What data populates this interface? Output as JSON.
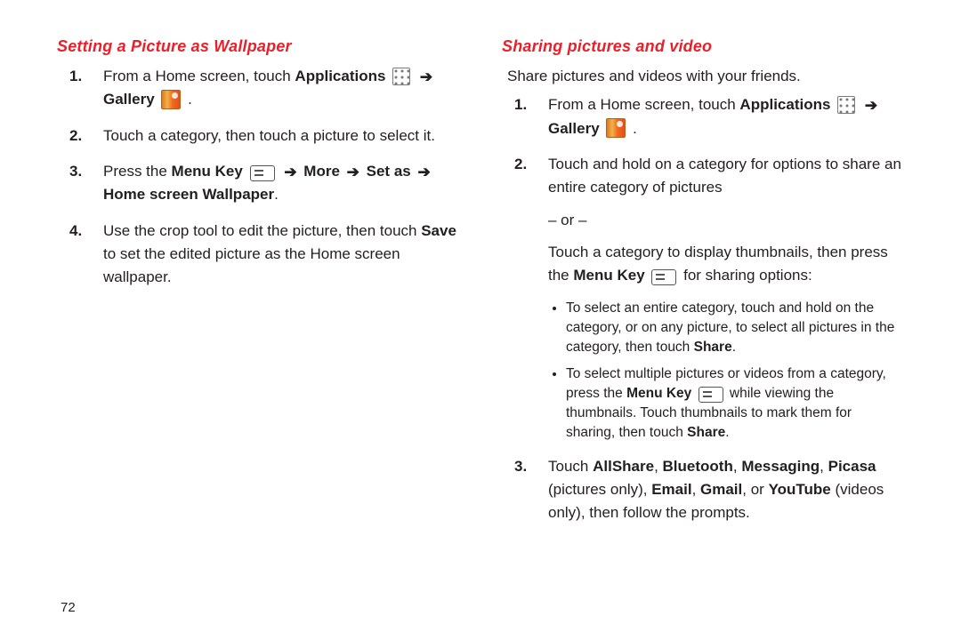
{
  "left": {
    "title": "Setting a Picture as Wallpaper",
    "steps": {
      "s1a": "From a Home screen, touch ",
      "s1_applications": "Applications",
      "s1_gallery": "Gallery",
      "period": ".",
      "s2": "Touch a category, then touch a picture to select it.",
      "s3a": "Press the ",
      "s3_menu": "Menu Key",
      "s3_more": "More",
      "s3_setas": "Set as",
      "s3_home": "Home screen Wallpaper",
      "s4a": "Use the crop tool to edit the picture, then touch ",
      "s4_save": "Save",
      "s4b": " to set the edited picture as the Home screen wallpaper."
    }
  },
  "right": {
    "title": "Sharing pictures and video",
    "intro": "Share pictures and videos with your friends.",
    "steps": {
      "s1a": "From a Home screen, touch ",
      "s1_applications": "Applications",
      "s1_gallery": "Gallery",
      "period": ".",
      "s2a": "Touch and hold on a category for options to share an entire category of pictures",
      "or": "– or –",
      "s2b": "Touch a category to display thumbnails, then press the ",
      "s2_menu": "Menu Key",
      "s2c": " for sharing options:",
      "b1a": "To select an entire category, touch and hold on the category, or on any picture, to select all pictures in the category, then touch ",
      "b1_share": "Share",
      "b2a": "To select multiple pictures or videos from a category, press the ",
      "b2_menu": "Menu Key",
      "b2b": " while viewing the thumbnails. Touch thumbnails to mark them for sharing, then touch ",
      "b2_share": "Share",
      "s3a": "Touch ",
      "s3_allshare": "AllShare",
      "comma": ", ",
      "s3_bluetooth": "Bluetooth",
      "s3_messaging": "Messaging",
      "s3_picasa": "Picasa",
      "s3_po": " (pictures only), ",
      "s3_email": "Email",
      "s3_gmail": "Gmail",
      "s3_or": ", or ",
      "s3_youtube": "YouTube",
      "s3_vo": " (videos only), then follow the prompts."
    }
  },
  "page_number": "72",
  "arrow": "➔"
}
